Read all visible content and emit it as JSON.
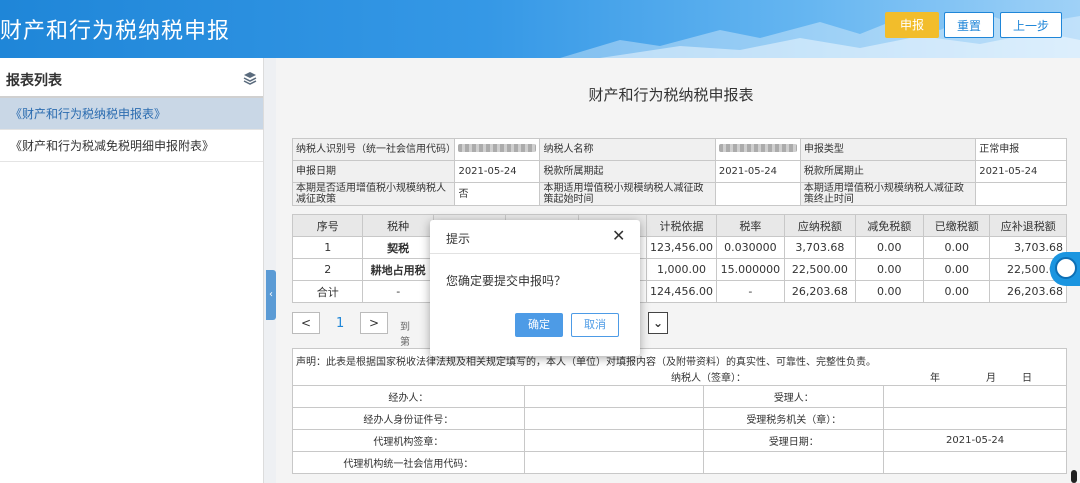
{
  "header": {
    "title": "财产和行为税纳税申报",
    "submit_label": "申报",
    "reset_label": "重置",
    "back_label": "上一步"
  },
  "sidebar": {
    "title": "报表列表",
    "items": [
      {
        "label": "《财产和行为税纳税申报表》",
        "active": true
      },
      {
        "label": "《财产和行为税减免税明细申报附表》",
        "active": false
      }
    ]
  },
  "main": {
    "title": "财产和行为税纳税申报表",
    "info": {
      "taxpayer_id_label": "纳税人识别号（统一社会信用代码）",
      "taxpayer_name_label": "纳税人名称",
      "declare_type_label": "申报类型",
      "declare_type_value": "正常申报",
      "declare_date_label": "申报日期",
      "declare_date_value": "2021-05-24",
      "period_start_label": "税款所属期起",
      "period_start_value": "2021-05-24",
      "period_end_label": "税款所属期止",
      "period_end_value": "2021-05-24",
      "small_scale_label": "本期是否适用增值税小规模纳税人减征政策",
      "small_scale_value": "否",
      "policy_start_label": "本期适用增值税小规模纳税人减征政策起始时间",
      "policy_end_label": "本期适用增值税小规模纳税人减征政策终止时间"
    },
    "tax_table": {
      "headers": [
        "序号",
        "税种",
        "",
        "",
        "",
        "计税依据",
        "税率",
        "应纳税额",
        "减免税额",
        "已缴税额",
        "应补退税额"
      ],
      "rows": [
        [
          "1",
          "契税",
          "",
          "",
          "",
          "123,456.00",
          "0.030000",
          "3,703.68",
          "0.00",
          "0.00",
          "3,703.68"
        ],
        [
          "2",
          "耕地占用税",
          "",
          "",
          "",
          "1,000.00",
          "15.000000",
          "22,500.00",
          "0.00",
          "0.00",
          "22,500.00"
        ],
        [
          "合计",
          "-",
          "",
          "",
          "",
          "124,456.00",
          "-",
          "26,203.68",
          "0.00",
          "0.00",
          "26,203.68"
        ]
      ]
    },
    "pager": {
      "prev": "<",
      "page": "1",
      "next": ">",
      "goto_label": "到第",
      "select_caret": "⌄"
    },
    "declaration": {
      "statement": "声明：此表是根据国家税收法律法规及相关规定填写的，本人（单位）对填报内容（及附带资料）的真实性、可靠性、完整性负责。",
      "signature_label": "纳税人（签章）：",
      "year": "年",
      "month": "月",
      "day": "日",
      "handler_label": "经办人：",
      "handler_id_label": "经办人身份证件号：",
      "agency_seal_label": "代理机构签章：",
      "agency_code_label": "代理机构统一社会信用代码：",
      "receiver_label": "受理人：",
      "receiver_office_label": "受理税务机关（章）：",
      "receive_date_label": "受理日期：",
      "receive_date_value": "2021-05-24"
    }
  },
  "modal": {
    "title": "提示",
    "close": "✕",
    "message": "您确定要提交申报吗？",
    "ok_label": "确定",
    "cancel_label": "取消"
  },
  "colors": {
    "header_blue": "#1f86d8",
    "submit_yellow": "#f2bd2b",
    "modal_ok_blue": "#4d9be6"
  },
  "icons": [
    "layers-icon",
    "close-icon",
    "chevron-left-icon",
    "customer-service-icon"
  ]
}
